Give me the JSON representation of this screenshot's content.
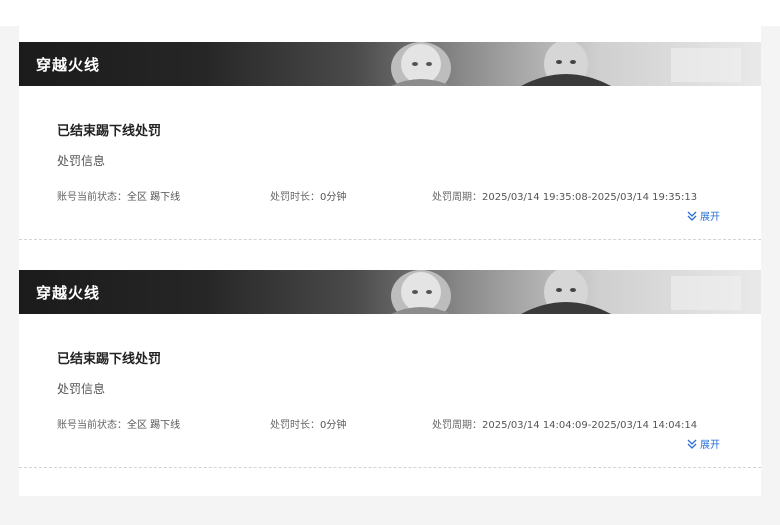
{
  "records": [
    {
      "game_title": "穿越火线",
      "status_title": "已结束踢下线处罚",
      "section_label": "处罚信息",
      "account_status_label": "账号当前状态：",
      "account_status_value": "全区 踢下线",
      "duration_label": "处罚时长：",
      "duration_value": "0分钟",
      "period_label": "处罚周期：",
      "period_value": "2025/03/14 19:35:08-2025/03/14 19:35:13",
      "expand_label": "展开"
    },
    {
      "game_title": "穿越火线",
      "status_title": "已结束踢下线处罚",
      "section_label": "处罚信息",
      "account_status_label": "账号当前状态：",
      "account_status_value": "全区 踢下线",
      "duration_label": "处罚时长：",
      "duration_value": "0分钟",
      "period_label": "处罚周期：",
      "period_value": "2025/03/14 14:04:09-2025/03/14 14:04:14",
      "expand_label": "展开"
    }
  ],
  "colors": {
    "accent": "#2a6fd6",
    "banner_dark": "#1b1b1b"
  }
}
